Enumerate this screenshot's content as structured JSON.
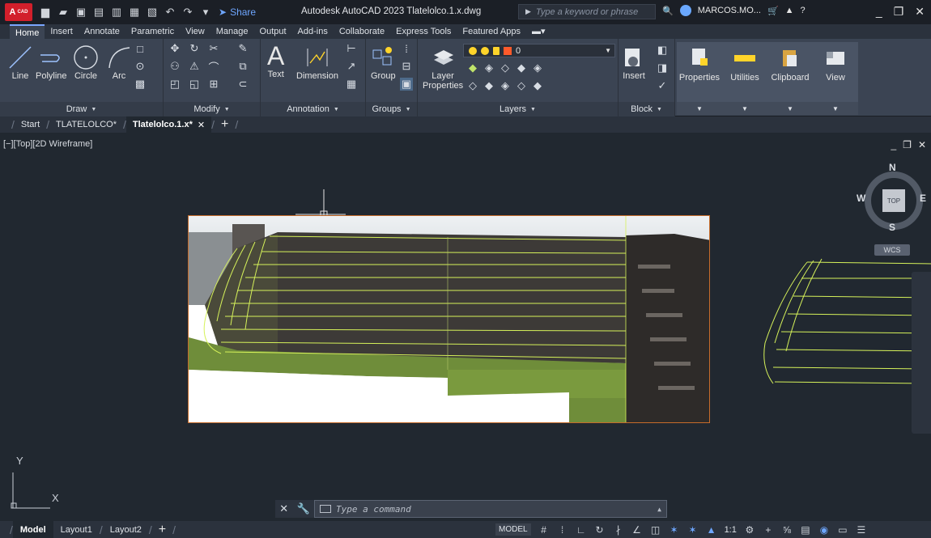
{
  "title": {
    "app_logo": "A",
    "app_logo_sub": "CAD",
    "share": "Share",
    "title_text": "Autodesk AutoCAD 2023   Tlatelolco.1.x.dwg",
    "search_placeholder": "Type a keyword or phrase",
    "user": "MARCOS.MO..."
  },
  "ribbon_tabs": [
    "Home",
    "Insert",
    "Annotate",
    "Parametric",
    "View",
    "Manage",
    "Output",
    "Add-ins",
    "Collaborate",
    "Express Tools",
    "Featured Apps"
  ],
  "ribbon": {
    "draw": {
      "line": "Line",
      "polyline": "Polyline",
      "circle": "Circle",
      "arc": "Arc",
      "label": "Draw"
    },
    "modify": {
      "label": "Modify"
    },
    "annotation": {
      "text": "Text",
      "dimension": "Dimension",
      "label": "Annotation"
    },
    "groups": {
      "group": "Group",
      "label": "Groups"
    },
    "layers": {
      "layer_properties_1": "Layer",
      "layer_properties_2": "Properties",
      "layer_name": "0",
      "label": "Layers"
    },
    "block": {
      "insert": "Insert",
      "label": "Block"
    },
    "tiles": [
      "Properties",
      "Utilities",
      "Clipboard",
      "View"
    ]
  },
  "file_tabs": {
    "start": "Start",
    "tab1": "TLATELOLCO*",
    "tab2": "Tlatelolco.1.x*"
  },
  "viewport": {
    "label": "[−][Top][2D Wireframe]",
    "viewcube": {
      "n": "N",
      "s": "S",
      "e": "E",
      "w": "W",
      "top": "TOP",
      "wcs": "WCS"
    },
    "ucs_x": "X",
    "ucs_y": "Y"
  },
  "command": {
    "placeholder": "Type a command"
  },
  "status": {
    "layouts": [
      "Model",
      "Layout1",
      "Layout2"
    ],
    "model": "MODEL",
    "scale": "1:1"
  }
}
